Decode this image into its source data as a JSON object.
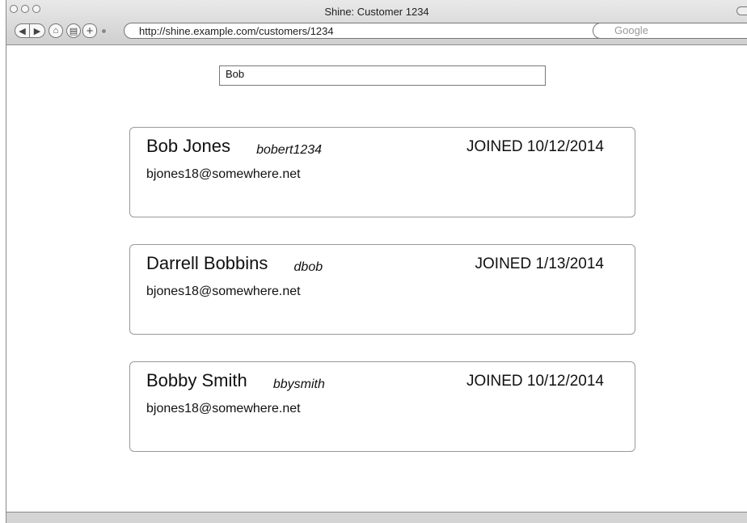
{
  "window": {
    "title": "Shine: Customer 1234",
    "url": "http://shine.example.com/customers/1234",
    "search_engine": "Google"
  },
  "search": {
    "value": "Bob"
  },
  "customers": [
    {
      "name": "Bob Jones",
      "handle": "bobert1234",
      "joined": "JOINED 10/12/2014",
      "email": "bjones18@somewhere.net"
    },
    {
      "name": "Darrell Bobbins",
      "handle": "dbob",
      "joined": "JOINED 1/13/2014",
      "email": "bjones18@somewhere.net"
    },
    {
      "name": "Bobby Smith",
      "handle": "bbysmith",
      "joined": "JOINED 10/12/2014",
      "email": "bjones18@somewhere.net"
    }
  ],
  "toolbar": {
    "back_glyph": "◀",
    "forward_glyph": "▶",
    "home_glyph": "⌂",
    "print_glyph": "▤",
    "add_glyph": "+"
  }
}
